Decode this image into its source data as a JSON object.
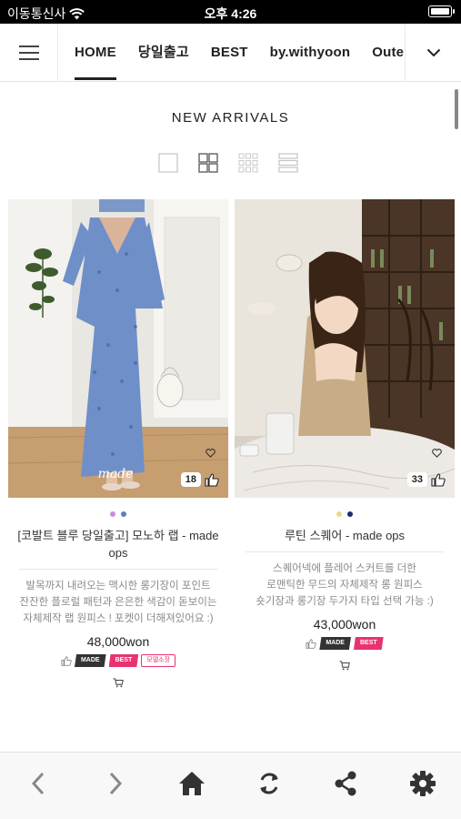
{
  "status_bar": {
    "carrier": "이동통신사",
    "time": "오후 4:26"
  },
  "nav": {
    "tabs": [
      {
        "label": "HOME",
        "active": true
      },
      {
        "label": "당일출고",
        "active": false
      },
      {
        "label": "BEST",
        "active": false
      },
      {
        "label": "by.withyoon",
        "active": false
      },
      {
        "label": "Outer",
        "active": false
      }
    ]
  },
  "section": {
    "title": "NEW ARRIVALS"
  },
  "view_toggles": [
    "single-view-icon",
    "grid-2-view-icon",
    "grid-3-view-icon",
    "list-view-icon"
  ],
  "products": [
    {
      "name": "[코발트 블루 당일출고] 모노하 랩 - made ops",
      "description": [
        "발목까지 내려오는 맥시한 롱기장이 포인트",
        "잔잔한 플로럴 패턴과 은은한 색감이 돋보이는",
        "자체제작 랩 원피스 ! 포켓이 더해져있어요 :)"
      ],
      "price": "48,000won",
      "likes": "18",
      "colors": [
        "#c98fd8",
        "#5b7fb8"
      ],
      "badges": {
        "made": "MADE",
        "best": "BEST",
        "model": "모델소장"
      },
      "photo_watermark": "made"
    },
    {
      "name": "루틴 스퀘어 - made ops",
      "description": [
        "스퀘어넥에 플레어 스커트를 더한",
        "로맨틱한 무드의 자체제작 롱 원피스",
        "숏기장과 롱기장 두가지 타입 선택 가능 :)"
      ],
      "price": "43,000won",
      "likes": "33",
      "colors": [
        "#e6d98a",
        "#1d2a6e"
      ],
      "badges": {
        "made": "MADE",
        "best": "BEST"
      }
    }
  ],
  "bottom_bar": [
    "back-icon",
    "forward-icon",
    "home-icon",
    "refresh-icon",
    "share-icon",
    "settings-icon"
  ]
}
